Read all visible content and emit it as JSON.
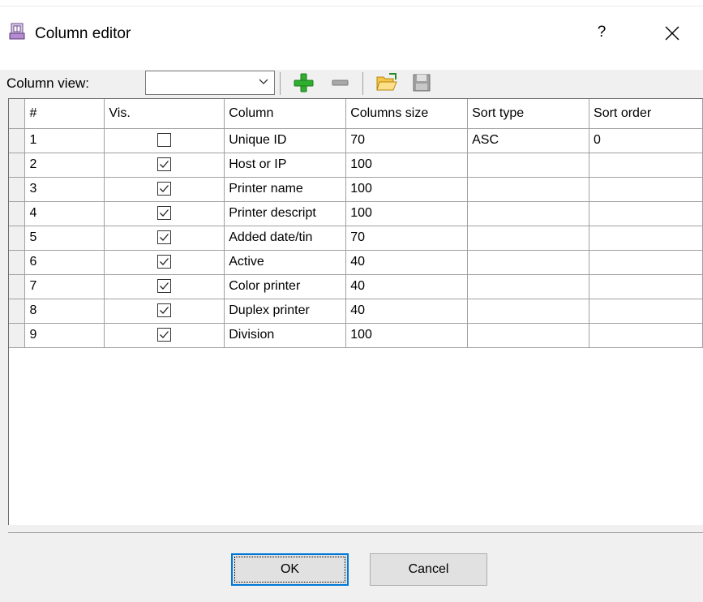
{
  "window": {
    "title": "Column editor",
    "help_label": "?",
    "icons": {
      "app": "column-editor-app-icon",
      "close": "close-icon"
    }
  },
  "toolbar": {
    "column_view_label": "Column view:",
    "column_view_value": "",
    "buttons": [
      {
        "name": "add-icon",
        "color": "#2aa52a"
      },
      {
        "name": "remove-icon",
        "color": "#9a9a9a"
      },
      {
        "name": "open-folder-icon",
        "color": "#e8b423"
      },
      {
        "name": "save-icon",
        "color": "#8c8c8c"
      }
    ]
  },
  "grid": {
    "columns": [
      "#",
      "Vis.",
      "Column",
      "Columns size",
      "Sort type",
      "Sort order"
    ],
    "rows": [
      {
        "num": "1",
        "visible": false,
        "column": "Unique ID",
        "size": "70",
        "sort_type": "ASC",
        "sort_order": "0"
      },
      {
        "num": "2",
        "visible": true,
        "column": "Host or IP",
        "size": "100",
        "sort_type": "",
        "sort_order": ""
      },
      {
        "num": "3",
        "visible": true,
        "column": "Printer name",
        "size": "100",
        "sort_type": "",
        "sort_order": ""
      },
      {
        "num": "4",
        "visible": true,
        "column": "Printer descript",
        "size": "100",
        "sort_type": "",
        "sort_order": ""
      },
      {
        "num": "5",
        "visible": true,
        "column": "Added date/tin",
        "size": "70",
        "sort_type": "",
        "sort_order": ""
      },
      {
        "num": "6",
        "visible": true,
        "column": "Active",
        "size": "40",
        "sort_type": "",
        "sort_order": ""
      },
      {
        "num": "7",
        "visible": true,
        "column": "Color printer",
        "size": "40",
        "sort_type": "",
        "sort_order": ""
      },
      {
        "num": "8",
        "visible": true,
        "column": "Duplex printer",
        "size": "40",
        "sort_type": "",
        "sort_order": ""
      },
      {
        "num": "9",
        "visible": true,
        "column": "Division",
        "size": "100",
        "sort_type": "",
        "sort_order": ""
      }
    ]
  },
  "buttons": {
    "ok": "OK",
    "cancel": "Cancel"
  },
  "colors": {
    "accent": "#0078d7",
    "dialog_bg": "#f0f0f0"
  }
}
